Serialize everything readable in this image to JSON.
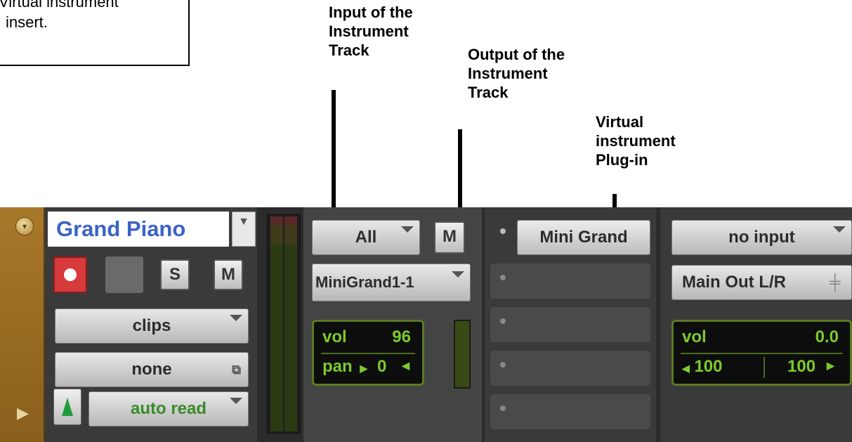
{
  "callout": {
    "line1": "Virtual instrument",
    "line2": "insert."
  },
  "annotations": {
    "input_label": "Input of the\nInstrument\nTrack",
    "output_label": "Output of the\nInstrument\nTrack",
    "plugin_label": "Virtual\ninstrument\nPlug-in"
  },
  "track": {
    "name": "Grand Piano",
    "solo_label": "S",
    "mute_label": "M",
    "playlist_label": "clips",
    "view_label": "none",
    "automation_label": "auto read"
  },
  "io_a": {
    "input_label": "All",
    "mono_label": "M",
    "output_label": "MiniGrand1-1",
    "vol_label": "vol",
    "vol_value": "96",
    "pan_label": "pan",
    "pan_value": "0"
  },
  "inserts": {
    "slot1_label": "Mini Grand"
  },
  "io_b": {
    "input_label": "no input",
    "output_label": "Main Out L/R",
    "vol_label": "vol",
    "vol_value": "0.0",
    "pan_left": "100",
    "pan_right": "100"
  },
  "colors": {
    "track_name": "#3b63c7",
    "record": "#d63a3a",
    "readout_green": "#7ccb2b"
  }
}
